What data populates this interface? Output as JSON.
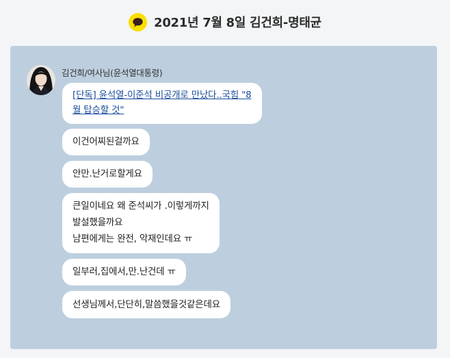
{
  "header": {
    "title": "2021년 7월 8일 김건희-명태균"
  },
  "colors": {
    "page_background": "#f3f5f7",
    "chat_background": "#bdcfdf",
    "bubble_background": "#ffffff",
    "kakao_yellow": "#f9e000",
    "kakao_brown": "#3c1e1e",
    "link_color": "#1a4c9a"
  },
  "chat": {
    "sender_name": "김건희/여사님(윤석열대통령)",
    "messages": [
      {
        "type": "link",
        "lines": [
          "[단독] 윤석열-이준석 비공개로 만났다..국힘 \"8",
          "월 탑승할 것\""
        ]
      },
      {
        "type": "text",
        "lines": [
          "이건어찌된걸까요"
        ]
      },
      {
        "type": "text",
        "lines": [
          "안만.난거로할게요"
        ]
      },
      {
        "type": "text",
        "lines": [
          "큰일이네요  왜  준석씨가 .이렇게까지",
          "발설했을까요",
          "남편에게는  완전,  악재인데요  ㅠ"
        ]
      },
      {
        "type": "text",
        "lines": [
          "일부러,집에서,만.난건데  ㅠ"
        ]
      },
      {
        "type": "text",
        "lines": [
          "선생님께서,단단히,말씀했을것같은데요"
        ]
      }
    ]
  }
}
